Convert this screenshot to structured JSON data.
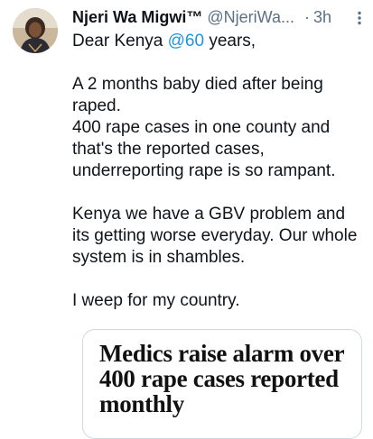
{
  "tweet": {
    "author": {
      "display_name": "Njeri Wa Migwi™",
      "handle": "@NjeriWa...",
      "avatar_icon": "profile-photo"
    },
    "separator": "·",
    "timestamp": "3h",
    "more_icon": "more-vertical-icon",
    "body": {
      "line1_prefix": "Dear Kenya ",
      "line1_mention": "@60",
      "line1_suffix": " years,",
      "para2": "A 2 months baby died after being raped.",
      "para3": "400 rape cases in one county and that's the reported cases, underreporting rape is so rampant.",
      "para4": "Kenya we have a GBV problem and its getting worse everyday. Our whole system is in shambles.",
      "para5": "I weep for my country."
    },
    "card": {
      "headline": "Medics raise alarm over 400 rape cases reported monthly"
    },
    "colors": {
      "text": "#0f1419",
      "secondary": "#5b7083",
      "link": "#1b95e0",
      "card_border": "#cfd9de"
    }
  }
}
